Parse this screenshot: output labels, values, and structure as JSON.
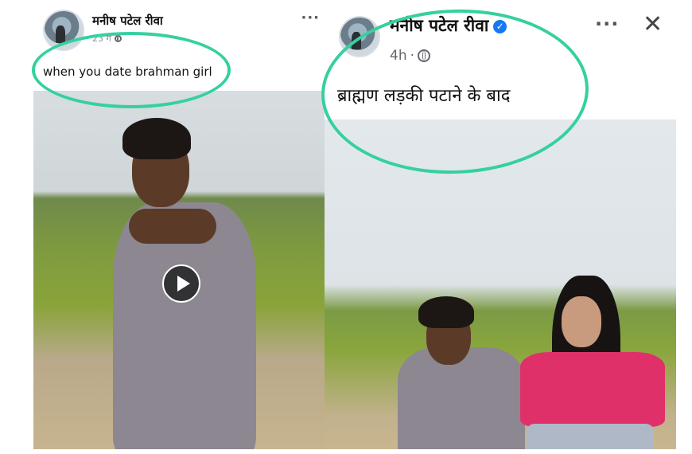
{
  "left_post": {
    "poster_name": "मनीष पटेल रीवा",
    "timestamp": "23 ग",
    "caption": "when you date brahman girl",
    "more_icon": "more-horizontal-icon"
  },
  "right_post": {
    "poster_name": "मनीष पटेल रीवा",
    "verified_icon": "✓",
    "timestamp": "4h",
    "separator": "·",
    "caption": "ब्राह्मण लड़की पटाने के बाद",
    "more_icon": "more-horizontal-icon",
    "close_icon": "close-icon"
  },
  "colors": {
    "highlight": "#35d0a0",
    "verified": "#1877f2"
  }
}
